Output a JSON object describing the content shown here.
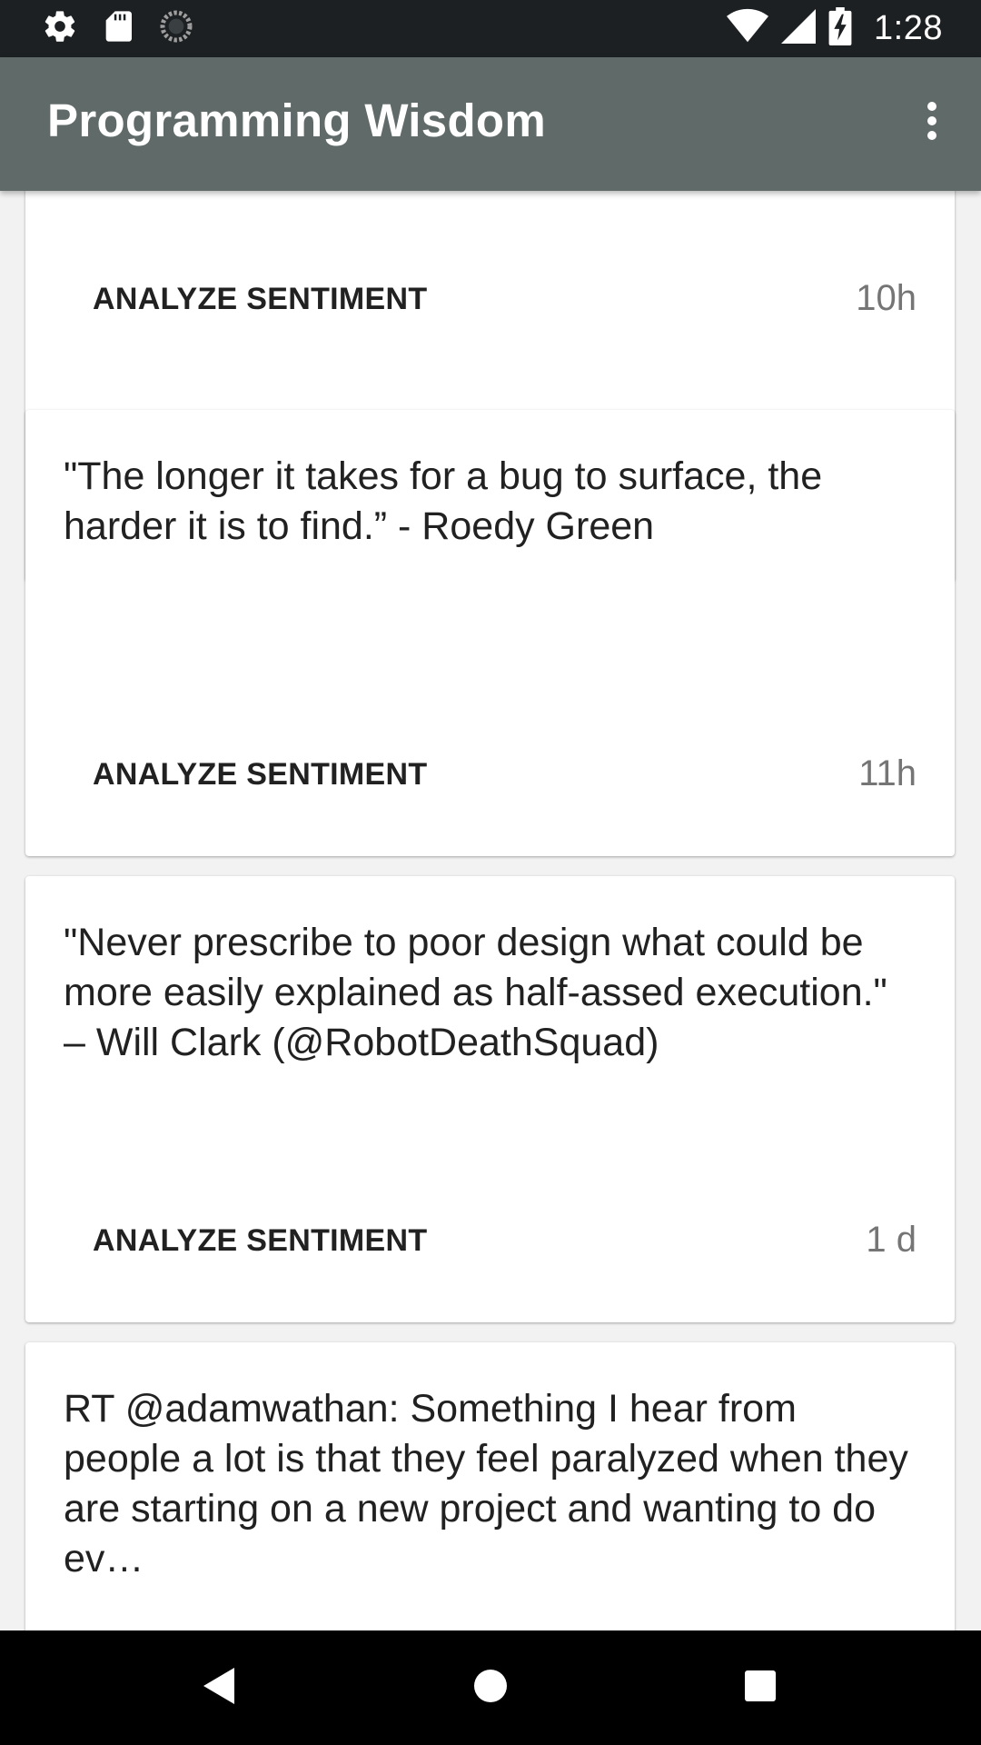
{
  "status_bar": {
    "time": "1:28",
    "left_icons": [
      "settings-icon",
      "sd-card-icon",
      "sync-icon"
    ],
    "right_icons": [
      "wifi-icon",
      "cell-signal-icon",
      "battery-charging-icon"
    ]
  },
  "app_bar": {
    "title": "Programming Wisdom",
    "menu_icon": "more-vert-icon"
  },
  "cards": [
    {
      "text": "",
      "action": "ANALYZE SENTIMENT",
      "time": "10h"
    },
    {
      "text": "\"The longer it takes for a bug to surface, the harder it is to find.” - Roedy Green",
      "action": "ANALYZE SENTIMENT",
      "time": "11h"
    },
    {
      "text": "\"Never prescribe to poor design what could be more easily explained as half-assed execution.\"\n– Will Clark (@RobotDeathSquad)",
      "action": "ANALYZE SENTIMENT",
      "time": "1 d"
    },
    {
      "text": "RT @adamwathan: Something I hear from people a lot is that they feel paralyzed when they are starting on a new project and wanting to do ev…",
      "action": "",
      "time": ""
    }
  ],
  "nav_bar": {
    "icons": [
      "back-icon",
      "home-icon",
      "recents-icon"
    ]
  },
  "colors": {
    "status_bar": "#1c2022",
    "app_bar": "#5f6a69",
    "background": "#f2f2f2",
    "card": "#ffffff",
    "timestamp": "#757575",
    "nav_bar": "#000000"
  }
}
